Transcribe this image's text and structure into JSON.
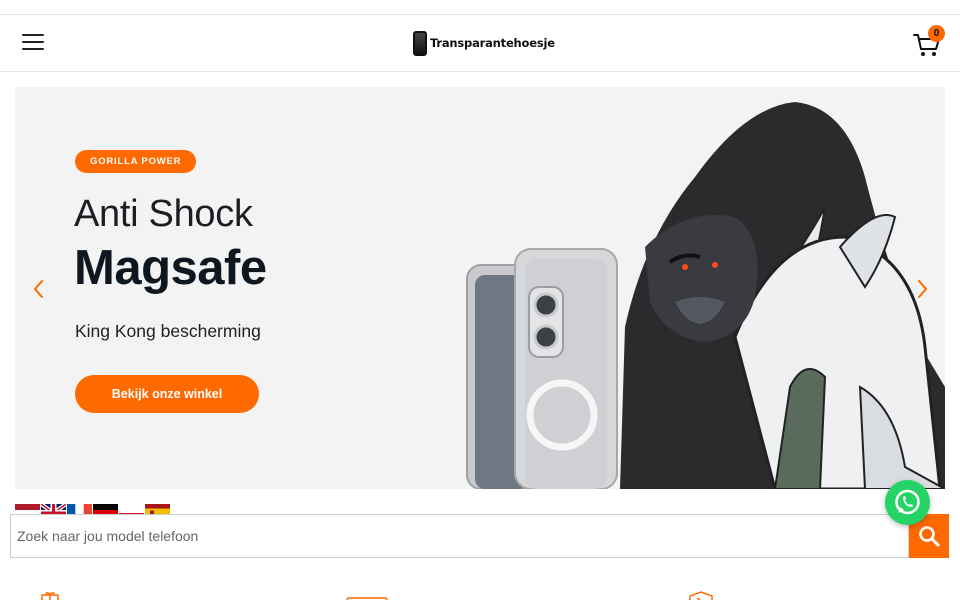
{
  "header": {
    "logo_text": "Transparantehoesje",
    "cart_count": "0",
    "icons": {
      "menu": "hamburger-menu-icon",
      "cart": "shopping-cart-icon",
      "logo": "phone-logo-icon"
    }
  },
  "hero": {
    "badge": "GORILLA POWER",
    "headline_line1": "Anti Shock",
    "headline_line2": "Magsafe",
    "subline": "King Kong bescherming",
    "cta_label": "Bekijk onze winkel",
    "icons": {
      "prev": "chevron-left-icon",
      "next": "chevron-right-icon"
    }
  },
  "languages": [
    {
      "code": "nl",
      "icon": "flag-netherlands-icon"
    },
    {
      "code": "en",
      "icon": "flag-uk-icon"
    },
    {
      "code": "fr",
      "icon": "flag-france-icon"
    },
    {
      "code": "de",
      "icon": "flag-germany-icon"
    },
    {
      "code": "pl",
      "icon": "flag-poland-icon"
    },
    {
      "code": "es",
      "icon": "flag-spain-icon"
    }
  ],
  "search": {
    "placeholder": "Zoek naar jou model telefoon",
    "value": "",
    "icon": "search-icon"
  },
  "whatsapp": {
    "icon": "whatsapp-icon"
  },
  "colors": {
    "accent": "#ff6a00",
    "hero_bg": "#f3f3f3",
    "headline": "#0e1620",
    "whatsapp": "#25d366"
  }
}
